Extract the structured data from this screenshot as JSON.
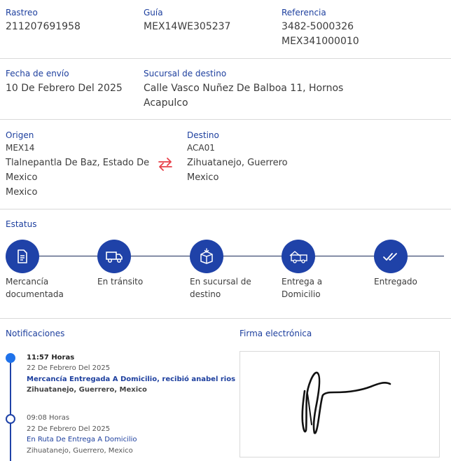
{
  "shipment": {
    "tracking_label": "Rastreo",
    "tracking_value": "211207691958",
    "guide_label": "Guía",
    "guide_value": "MEX14WE305237",
    "reference_label": "Referencia",
    "reference_values": [
      "3482-5000326",
      "MEX341000010"
    ],
    "ship_date_label": "Fecha de envío",
    "ship_date_value": "10 De Febrero Del 2025",
    "branch_label": "Sucursal de destino",
    "branch_lines": [
      "Calle Vasco Nuñez De Balboa 11, Hornos",
      "Acapulco"
    ]
  },
  "route": {
    "origin_label": "Origen",
    "origin_code": "MEX14",
    "origin_lines": [
      "Tlalnepantla De Baz, Estado De",
      "Mexico",
      "Mexico"
    ],
    "destination_label": "Destino",
    "destination_code": "ACA01",
    "destination_lines": [
      "Zihuatanejo, Guerrero",
      "Mexico"
    ],
    "swap_icon": "swap-arrows-icon",
    "accent_color": "#e8404a"
  },
  "status": {
    "label": "Estatus",
    "steps": [
      {
        "label_lines": [
          "Mercancía",
          "documentada"
        ],
        "icon": "document-icon"
      },
      {
        "label_lines": [
          "En tránsito"
        ],
        "icon": "truck-icon"
      },
      {
        "label_lines": [
          "En sucursal de",
          "destino"
        ],
        "icon": "package-icon"
      },
      {
        "label_lines": [
          "Entrega a",
          "Domicilio"
        ],
        "icon": "delivery-truck-icon"
      },
      {
        "label_lines": [
          "Entregado"
        ],
        "icon": "double-check-icon"
      }
    ],
    "step_color": "#1f42a8"
  },
  "notifications": {
    "label": "Notificaciones",
    "items": [
      {
        "time": "11:57 Horas",
        "date": "22 De Febrero Del 2025",
        "message": "Mercancía Entregada A Domicilio, recibió anabel rios",
        "location": "Zihuatanejo, Guerrero, Mexico"
      },
      {
        "time": "09:08 Horas",
        "date": "22 De Febrero Del 2025",
        "message": "En Ruta De Entrega A Domicilio",
        "location": "Zihuatanejo, Guerrero, Mexico"
      }
    ]
  },
  "signature": {
    "label": "Firma electrónica"
  }
}
